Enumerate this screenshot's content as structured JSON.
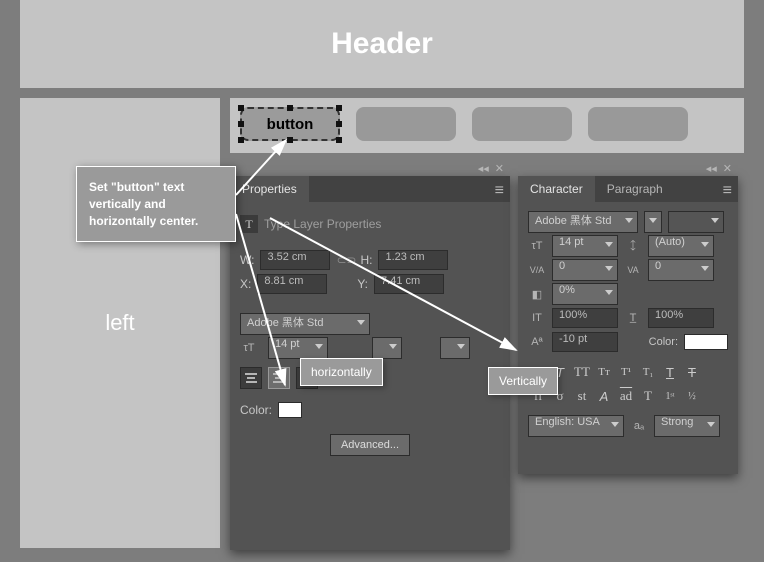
{
  "header": {
    "title": "Header"
  },
  "left": {
    "label": "left"
  },
  "selected_button": {
    "text": "button"
  },
  "callout": {
    "text": "Set \"button\" text vertically and horizontally center."
  },
  "tooltip_h": {
    "text": "horizontally"
  },
  "tooltip_v": {
    "text": "Vertically"
  },
  "props": {
    "tab": "Properties",
    "section": "Type Layer Properties",
    "w_label": "W:",
    "w": "3.52 cm",
    "h_label": "H:",
    "h": "1.23 cm",
    "x_label": "X:",
    "x": "8.81 cm",
    "y_label": "Y:",
    "y": "7.41 cm",
    "font": "Adobe 黑体 Std",
    "size": "14 pt",
    "color_label": "Color:",
    "advanced": "Advanced..."
  },
  "char": {
    "tab_character": "Character",
    "tab_paragraph": "Paragraph",
    "font": "Adobe 黑体 Std",
    "size": "14 pt",
    "leading": "(Auto)",
    "va": "0",
    "kern_metrics": "0",
    "pct": "0%",
    "scale_v": "100%",
    "scale_h": "100%",
    "baseline": "-10 pt",
    "color_label": "Color:",
    "lang": "English: USA",
    "aa": "Strong"
  }
}
